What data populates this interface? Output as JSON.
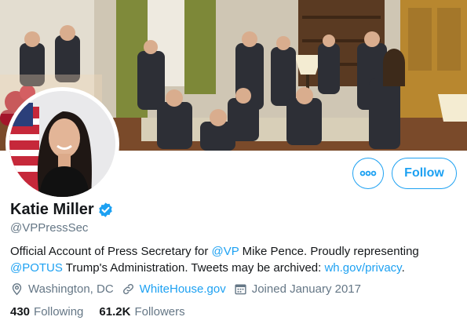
{
  "profile": {
    "name": "Katie Miller",
    "handle": "@VPPressSec",
    "verified": true
  },
  "bio": {
    "part1": "Official Account of Press Secretary for ",
    "mention_vp": "@VP",
    "part2": " Mike Pence. Proudly representing ",
    "mention_potus": "@POTUS",
    "part3": " Trump's Administration. Tweets may be archived: ",
    "archive_link": "wh.gov/privacy",
    "part4": "."
  },
  "meta": {
    "location": "Washington, DC",
    "website": "WhiteHouse.gov",
    "joined": "Joined January 2017"
  },
  "stats": {
    "following_count": "430",
    "following_label": "Following",
    "followers_count": "61.2K",
    "followers_label": "Followers"
  },
  "buttons": {
    "follow_label": "Follow"
  },
  "icons": {
    "more": "more-horizontal-icon",
    "verified": "verified-badge-icon",
    "location": "location-pin-icon",
    "link": "link-icon",
    "calendar": "calendar-icon"
  },
  "colors": {
    "accent": "#1da1f2",
    "muted": "#657786",
    "text": "#14171a"
  }
}
